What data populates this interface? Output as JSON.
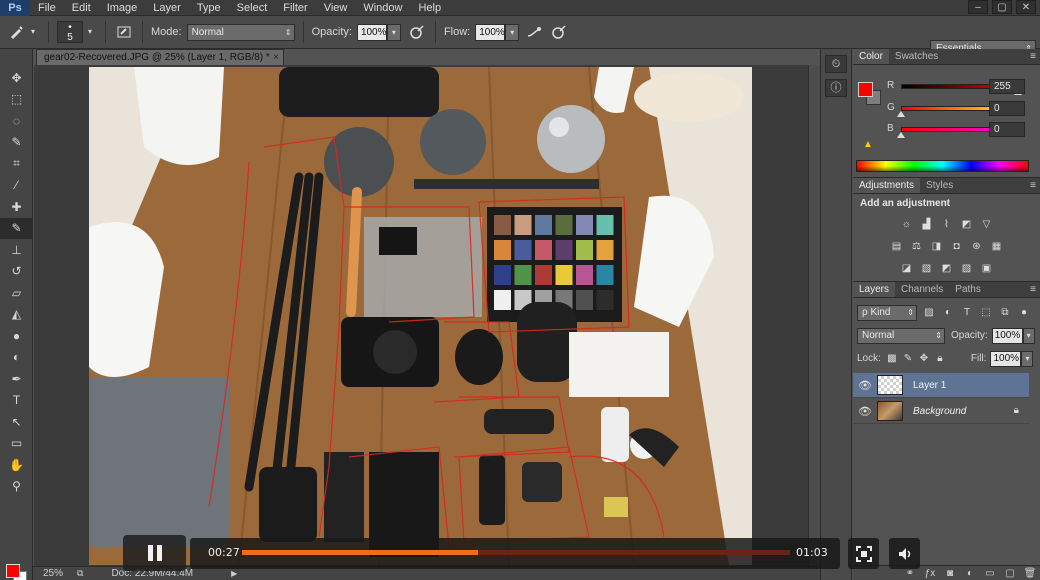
{
  "app": {
    "logo": "Ps"
  },
  "menu": [
    "File",
    "Edit",
    "Image",
    "Layer",
    "Type",
    "Select",
    "Filter",
    "View",
    "Window",
    "Help"
  ],
  "window_controls": [
    "–",
    "▢",
    "✕"
  ],
  "options": {
    "brush_size": "5",
    "mode_label": "Mode:",
    "mode_value": "Normal",
    "opacity_label": "Opacity:",
    "opacity_value": "100%",
    "flow_label": "Flow:",
    "flow_value": "100%",
    "workspace": "Essentials"
  },
  "document": {
    "tab_title": "gear02-Recovered.JPG @ 25% (Layer 1, RGB/8) *",
    "close": "×"
  },
  "status": {
    "zoom": "25%",
    "doc_info": "Doc: 22.9M/44.4M",
    "arrow": "▶"
  },
  "color_panel": {
    "tabs": [
      "Color",
      "Swatches"
    ],
    "channels": [
      {
        "label": "R",
        "value": "255",
        "level": 1.0
      },
      {
        "label": "G",
        "value": "0",
        "level": 0.0
      },
      {
        "label": "B",
        "value": "0",
        "level": 0.0
      }
    ],
    "foreground": "#ff0000",
    "background": "#7e7e7e"
  },
  "adjustments_panel": {
    "tabs": [
      "Adjustments",
      "Styles"
    ],
    "title": "Add an adjustment"
  },
  "layers_panel": {
    "tabs": [
      "Layers",
      "Channels",
      "Paths"
    ],
    "filter_kind": "ρ Kind",
    "blend_mode": "Normal",
    "opacity_label": "Opacity:",
    "opacity_value": "100%",
    "lock_label": "Lock:",
    "fill_label": "Fill:",
    "fill_value": "100%",
    "layers": [
      {
        "name": "Layer 1",
        "selected": true
      },
      {
        "name": "Background",
        "selected": false
      }
    ]
  },
  "video": {
    "current_time": "00:27",
    "total_time": "01:03",
    "progress": 0.43,
    "accent": "#f26b1d"
  }
}
